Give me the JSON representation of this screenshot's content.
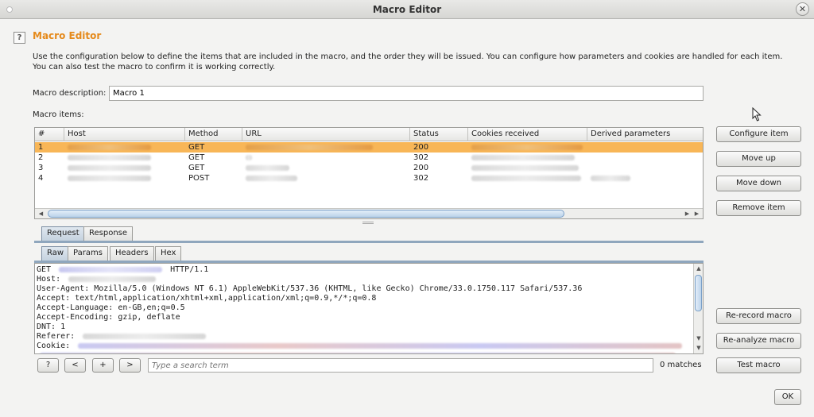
{
  "window": {
    "title": "Macro Editor",
    "close_glyph": "✕"
  },
  "header": {
    "help_glyph": "?",
    "title": "Macro Editor"
  },
  "description": "Use the configuration below to define the items that are included in the macro, and the order they will be issued. You can configure how parameters and cookies are handled for each item. You can also test the macro to confirm it is working correctly.",
  "macro_description": {
    "label": "Macro description:",
    "value": "Macro 1"
  },
  "macro_items_label": "Macro items:",
  "table": {
    "columns": [
      "#",
      "Host",
      "Method",
      "URL",
      "Status",
      "Cookies received",
      "Derived parameters"
    ],
    "rows": [
      {
        "num": "1",
        "method": "GET",
        "status": "200"
      },
      {
        "num": "2",
        "method": "GET",
        "status": "302"
      },
      {
        "num": "3",
        "method": "GET",
        "status": "200"
      },
      {
        "num": "4",
        "method": "POST",
        "status": "302"
      }
    ]
  },
  "side_buttons": {
    "configure": "Configure item",
    "move_up": "Move up",
    "move_down": "Move down",
    "remove": "Remove item",
    "rerecord": "Re-record macro",
    "reanalyze": "Re-analyze macro",
    "test": "Test macro",
    "ok": "OK"
  },
  "tabs_outer": [
    "Request",
    "Response"
  ],
  "tabs_inner": [
    "Raw",
    "Params",
    "Headers",
    "Hex"
  ],
  "request_lines": {
    "l1a": "GET",
    "l1b": "HTTP/1.1",
    "l2": "Host:",
    "l3": "User-Agent: Mozilla/5.0 (Windows NT 6.1) AppleWebKit/537.36 (KHTML, like Gecko) Chrome/33.0.1750.117 Safari/537.36",
    "l4": "Accept: text/html,application/xhtml+xml,application/xml;q=0.9,*/*;q=0.8",
    "l5": "Accept-Language: en-GB,en;q=0.5",
    "l6": "Accept-Encoding: gzip, deflate",
    "l7": "DNT: 1",
    "l8": "Referer:",
    "l9": "Cookie:"
  },
  "search": {
    "help": "?",
    "prev": "<",
    "add": "+",
    "next": ">",
    "placeholder": "Type a search term",
    "matches": "0 matches"
  }
}
